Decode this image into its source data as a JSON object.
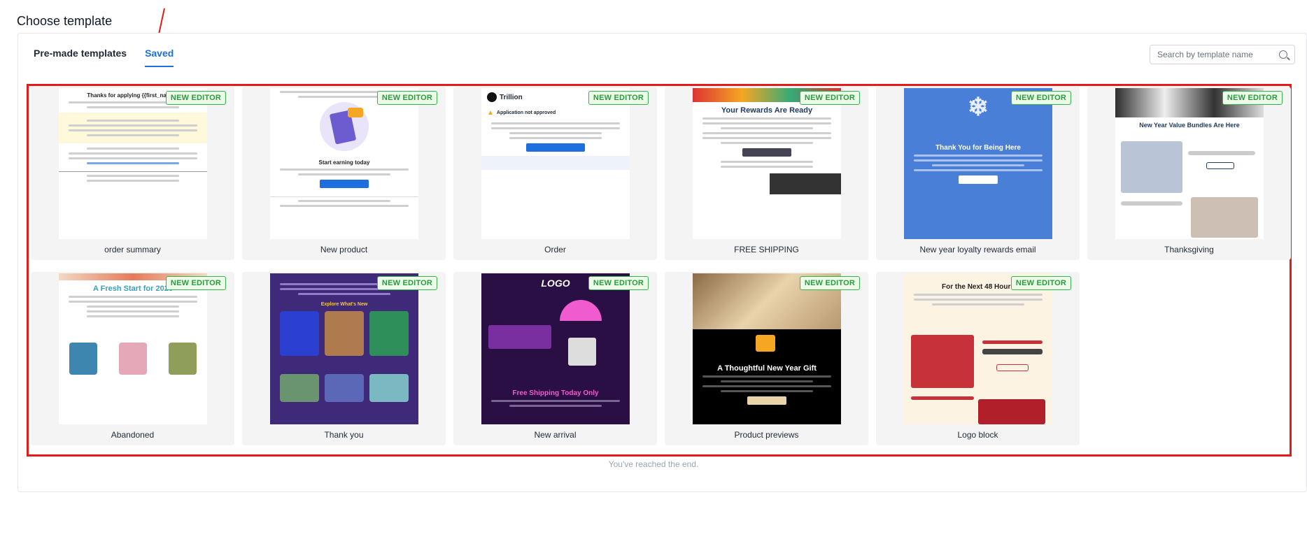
{
  "modal": {
    "title": "Choose template"
  },
  "tabs": [
    {
      "label": "Pre-made templates",
      "active": false
    },
    {
      "label": "Saved",
      "active": true
    }
  ],
  "search": {
    "placeholder": "Search by template name",
    "value": ""
  },
  "badge_label": "NEW EDITOR",
  "templates": [
    {
      "name": "order summary",
      "badge": true,
      "style": "approval",
      "headline": "Thanks for applying {{first_name}}"
    },
    {
      "name": "New product",
      "badge": true,
      "style": "referral",
      "headline": "Start earning today"
    },
    {
      "name": "Order",
      "badge": true,
      "style": "trillion",
      "headline": "Application not approved",
      "brand": "Trillion"
    },
    {
      "name": "FREE SHIPPING",
      "badge": true,
      "style": "rewards",
      "headline": "Your Rewards Are Ready"
    },
    {
      "name": "New year loyalty rewards email",
      "badge": true,
      "style": "newyear",
      "headline": "Thank You for Being Here"
    },
    {
      "name": "Thanksgiving",
      "badge": true,
      "style": "bundles",
      "headline": "New Year Value Bundles Are Here"
    },
    {
      "name": "Abandoned",
      "badge": true,
      "style": "freshstart",
      "headline": "A Fresh Start for 2026"
    },
    {
      "name": "Thank you",
      "badge": true,
      "style": "headphones",
      "headline": "Explore What's New"
    },
    {
      "name": "New arrival",
      "badge": true,
      "style": "shipping",
      "headline": "Free Shipping Today Only",
      "brand": "LOGO"
    },
    {
      "name": "Product previews",
      "badge": true,
      "style": "giftcard",
      "headline": "A Thoughtful New Year Gift"
    },
    {
      "name": "Logo block",
      "badge": true,
      "style": "sale48",
      "headline": "For the Next 48 Hours"
    }
  ],
  "end_message": "You've reached the end.",
  "colors": {
    "accent": "#1d6fe0",
    "highlight": "#e41b1b",
    "badge_green": "#2b9a3e"
  }
}
